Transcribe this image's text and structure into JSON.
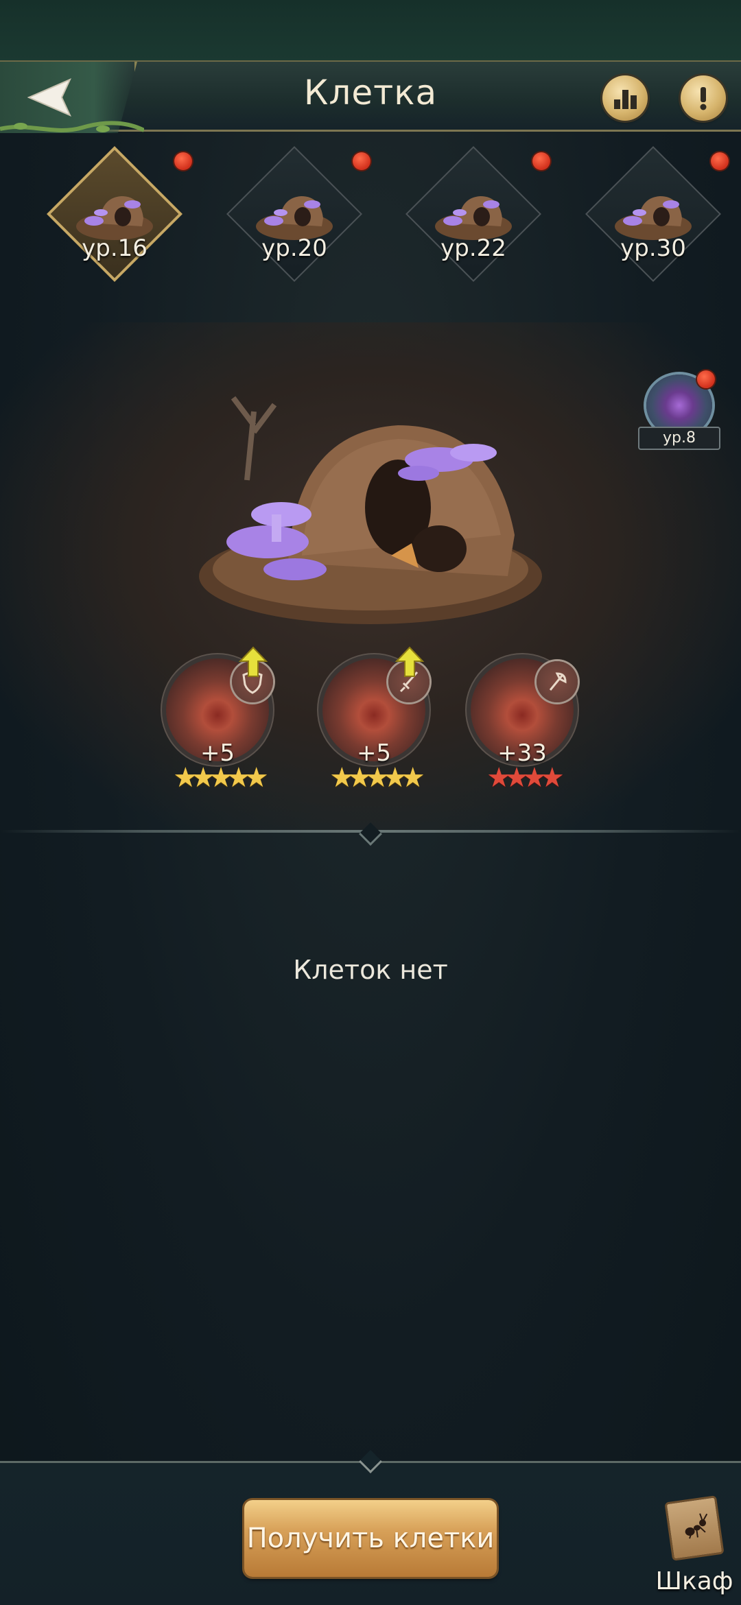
{
  "header": {
    "title": "Клетка"
  },
  "levels": [
    {
      "label": "ур.16",
      "active": true
    },
    {
      "label": "ур.20",
      "active": false
    },
    {
      "label": "ур.22",
      "active": false
    },
    {
      "label": "ур.30",
      "active": false
    }
  ],
  "side_badge": {
    "label": "ур.8"
  },
  "stats": [
    {
      "value": "+5",
      "stars": 5,
      "star_color": "gold",
      "icon": "shield-icon",
      "upgrade": true
    },
    {
      "value": "+5",
      "stars": 5,
      "star_color": "gold",
      "icon": "sword-icon",
      "upgrade": true
    },
    {
      "value": "+33",
      "stars": 4,
      "star_color": "red",
      "icon": "axe-icon",
      "upgrade": false
    }
  ],
  "content": {
    "empty_text": "Клеток нет"
  },
  "footer": {
    "get_button_label": "Получить клетки",
    "wardrobe_label": "Шкаф"
  },
  "colors": {
    "accent_gold": "#c7a864",
    "notification_red": "#d1301c",
    "star_gold": "#f2c94c",
    "star_red": "#e04a3a"
  }
}
